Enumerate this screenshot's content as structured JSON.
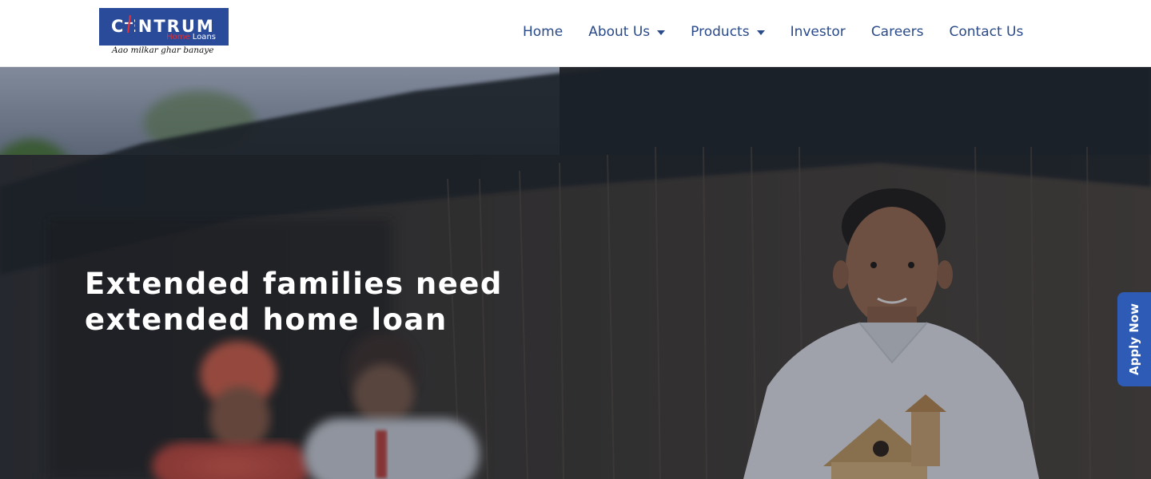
{
  "brand": {
    "name": "CENTRUM",
    "sub_home": "Home",
    "sub_loans": "Loans",
    "tagline": "Aao milkar ghar banaye",
    "colors": {
      "primary": "#2a4a9a",
      "accent_red": "#e0303a"
    }
  },
  "nav": {
    "items": [
      {
        "label": "Home",
        "has_dropdown": false
      },
      {
        "label": "About Us",
        "has_dropdown": true
      },
      {
        "label": "Products",
        "has_dropdown": true
      },
      {
        "label": "Investor",
        "has_dropdown": false
      },
      {
        "label": "Careers",
        "has_dropdown": false
      },
      {
        "label": "Contact Us",
        "has_dropdown": false
      }
    ],
    "color": "#2a4a8a"
  },
  "hero": {
    "title_line1": "Extended families need",
    "title_line2": "extended home loan"
  },
  "cta": {
    "apply_now": "Apply Now",
    "color": "#2d5bb5"
  }
}
